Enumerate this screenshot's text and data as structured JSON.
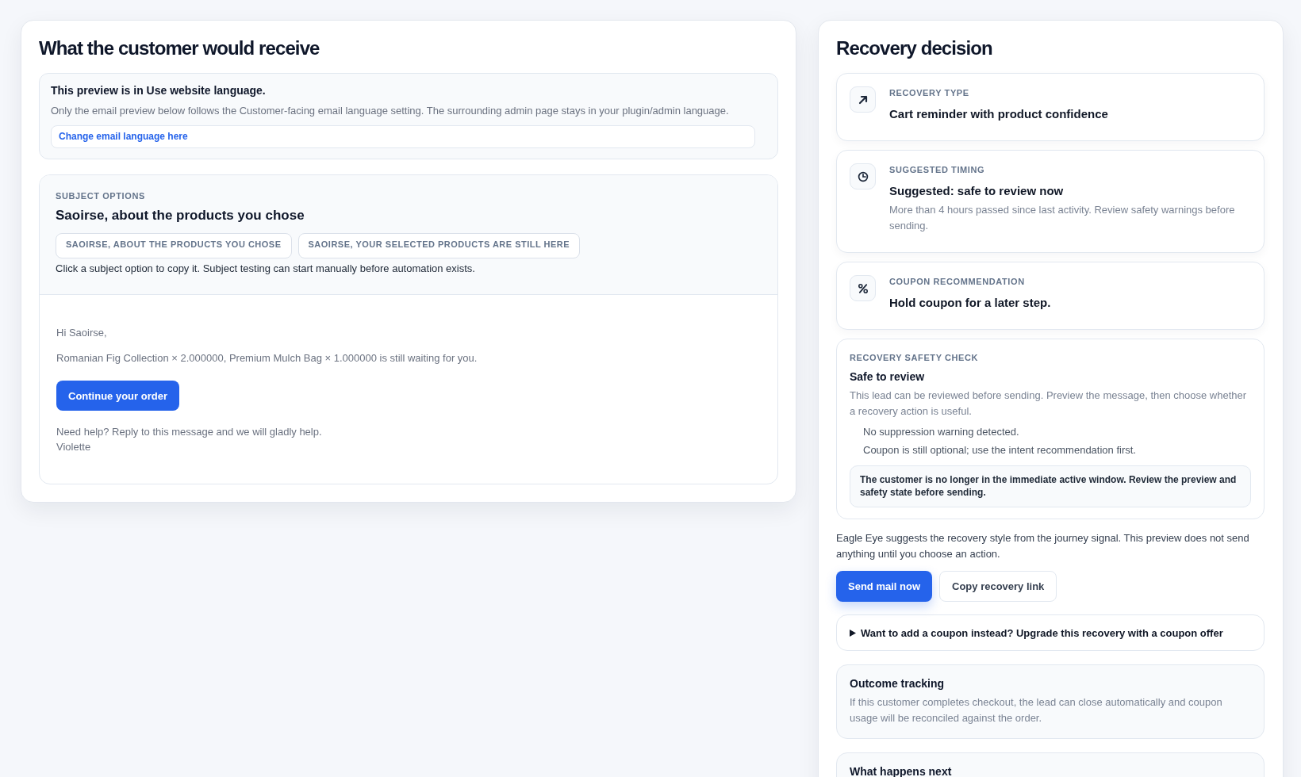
{
  "preview_panel": {
    "title": "What the customer would receive",
    "language_notice": {
      "heading": "This preview is in Use website language.",
      "text": "Only the email preview below follows the Customer-facing email language setting. The surrounding admin page stays in your plugin/admin language.",
      "link": "Change email language here"
    },
    "subject_options": {
      "label": "SUBJECT OPTIONS",
      "current_subject": "Saoirse, about the products you chose",
      "options": [
        "SAOIRSE, ABOUT THE PRODUCTS YOU CHOSE",
        "SAOIRSE, YOUR SELECTED PRODUCTS ARE STILL HERE"
      ],
      "hint": "Click a subject option to copy it. Subject testing can start manually before automation exists."
    },
    "email": {
      "greeting": "Hi Saoirse,",
      "body": "Romanian Fig Collection × 2.000000, Premium Mulch Bag × 1.000000 is still waiting for you.",
      "button": "Continue your order",
      "closing": "Need help? Reply to this message and we will gladly help.",
      "signature": "Violette"
    }
  },
  "decision_panel": {
    "title": "Recovery decision",
    "facts": [
      {
        "label": "RECOVERY TYPE",
        "value": "Cart reminder with product confidence"
      },
      {
        "label": "SUGGESTED TIMING",
        "value": "Suggested: safe to review now",
        "note": "More than 4 hours passed since last activity. Review safety warnings before sending."
      },
      {
        "label": "COUPON RECOMMENDATION",
        "value": "Hold coupon for a later step."
      }
    ],
    "safety_check": {
      "label": "RECOVERY SAFETY CHECK",
      "status": "Safe to review",
      "text": "This lead can be reviewed before sending. Preview the message, then choose whether a recovery action is useful.",
      "items": [
        "No suppression warning detected.",
        "Coupon is still optional; use the intent recommendation first."
      ],
      "warning": "The customer is no longer in the immediate active window. Review the preview and safety state before sending."
    },
    "explanation": "Eagle Eye suggests the recovery style from the journey signal. This preview does not send anything until you choose an action.",
    "actions": [
      {
        "label": "Send mail now",
        "kind": "primary"
      },
      {
        "label": "Copy recovery link",
        "kind": "secondary"
      }
    ],
    "coupon_upsell": {
      "summary": "Want to add a coupon instead? Upgrade this recovery with a coupon offer",
      "expanded": false
    },
    "outcome_tracking": {
      "title": "Outcome tracking",
      "text": "If this customer completes checkout, the lead can close automatically and coupon usage will be reconciled against the order."
    },
    "next_steps": {
      "title": "What happens next"
    }
  }
}
